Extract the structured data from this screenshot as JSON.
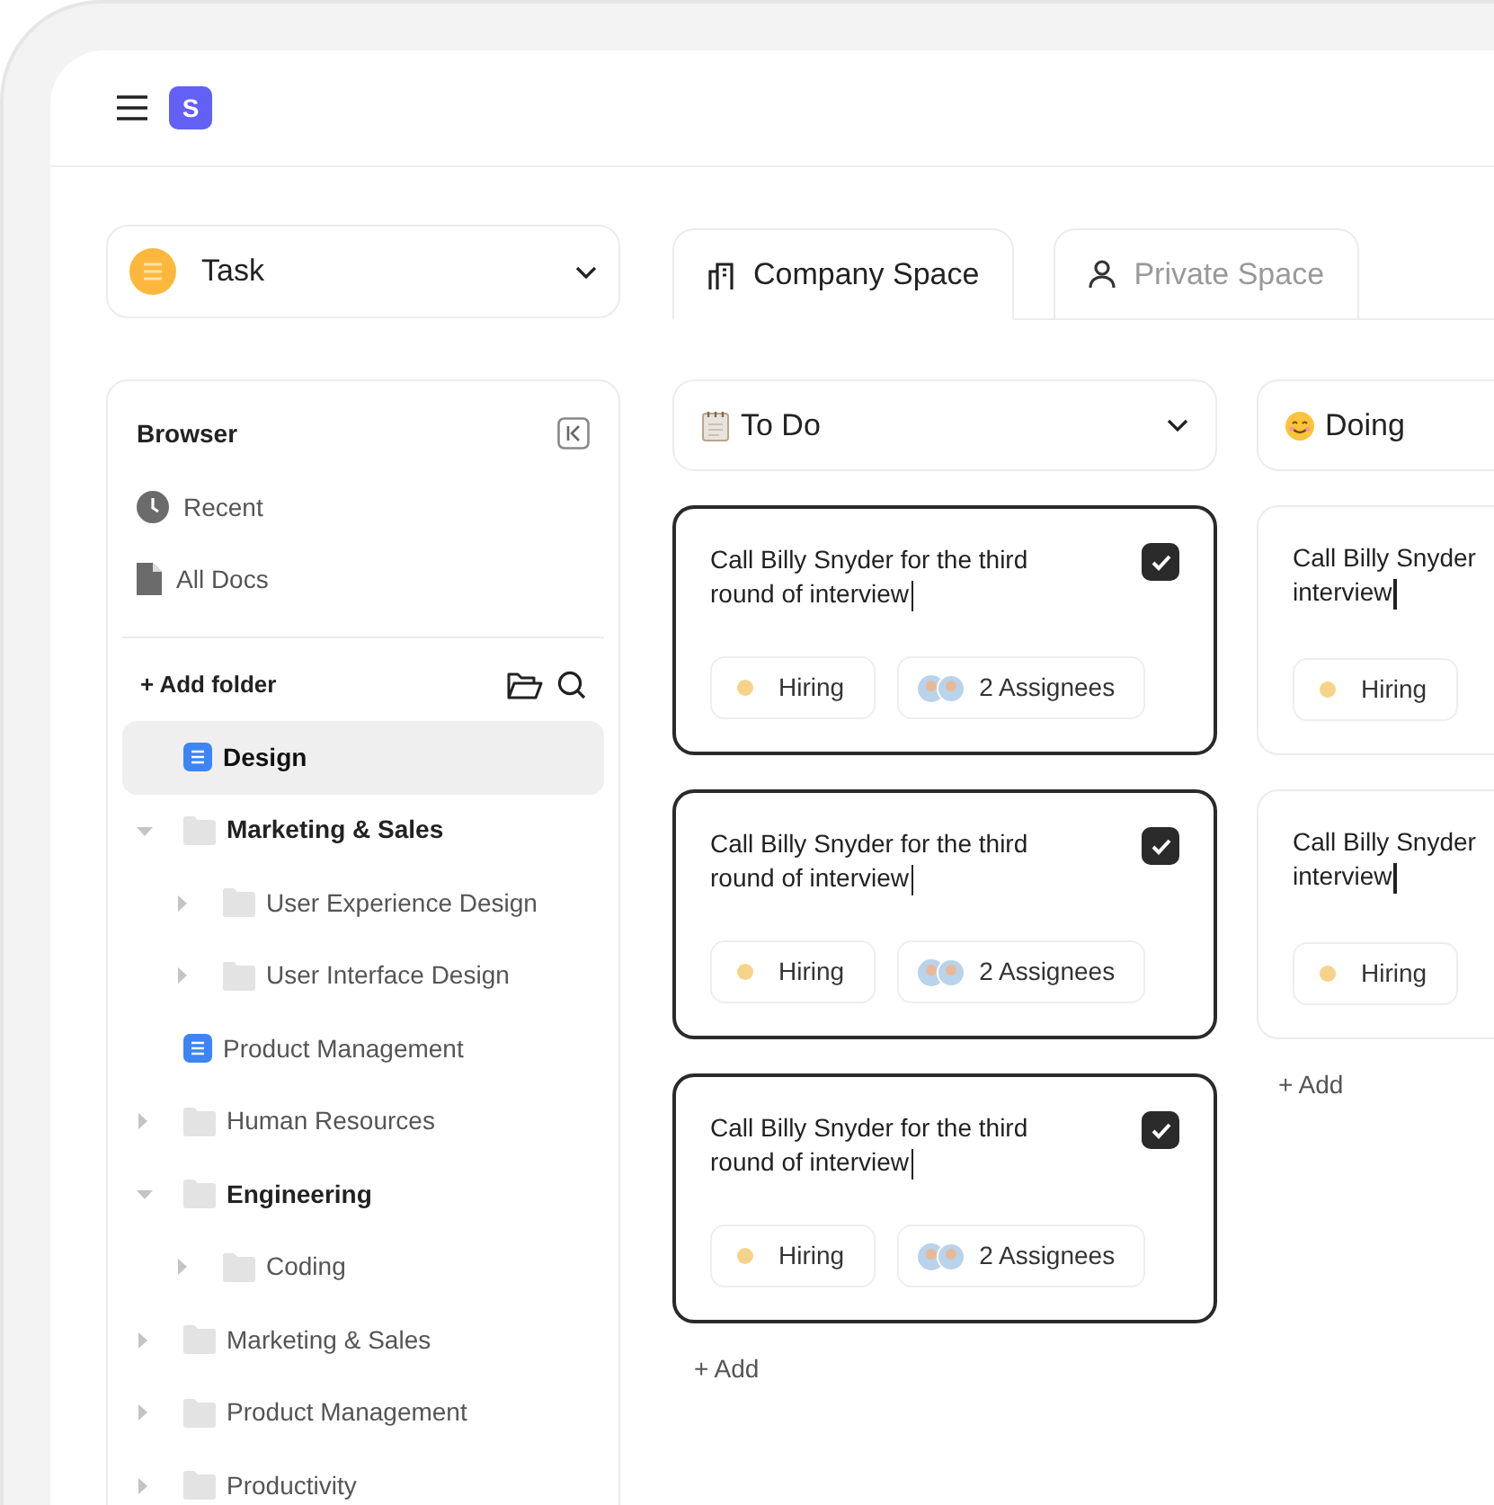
{
  "header": {
    "logo": "S"
  },
  "workspace_select": {
    "value": "Task"
  },
  "tabs": [
    {
      "label": "Company Space",
      "selected": true
    },
    {
      "label": "Private Space",
      "selected": false
    }
  ],
  "sidebar": {
    "title": "Browser",
    "links": [
      {
        "label": "Recent"
      },
      {
        "label": "All Docs"
      }
    ],
    "add_folder": "+ Add folder",
    "tree": [
      {
        "label": "Design",
        "kind": "doc",
        "selected": true
      },
      {
        "label": "Marketing & Sales",
        "kind": "folder",
        "expanded": true,
        "selected": false,
        "children": [
          {
            "label": "User Experience Design",
            "kind": "folder",
            "expanded": false,
            "selected": false
          },
          {
            "label": "User Interface Design",
            "kind": "folder",
            "expanded": false,
            "selected": false
          }
        ]
      },
      {
        "label": "Product Management",
        "kind": "doc",
        "selected": false
      },
      {
        "label": "Human Resources",
        "kind": "folder",
        "expanded": false,
        "selected": false
      },
      {
        "label": "Engineering",
        "kind": "folder",
        "expanded": true,
        "selected": false,
        "children": [
          {
            "label": "Coding",
            "kind": "folder",
            "expanded": false,
            "selected": false
          }
        ]
      },
      {
        "label": "Marketing & Sales",
        "kind": "folder",
        "expanded": false,
        "selected": false
      },
      {
        "label": "Product Management",
        "kind": "folder",
        "expanded": false,
        "selected": false
      },
      {
        "label": "Productivity",
        "kind": "folder",
        "expanded": false,
        "selected": false
      }
    ]
  },
  "board": {
    "columns": [
      {
        "title": "To Do",
        "dropdown": true,
        "add": "+ Add",
        "cards": [
          {
            "lines": [
              "Call Billy Snyder for the third",
              "round of interview"
            ],
            "checked": true,
            "tag": "Hiring",
            "color": "#f5d38a",
            "assignees": "2 Assignees",
            "active": true
          },
          {
            "lines": [
              "Call Billy Snyder for the third",
              "round of interview"
            ],
            "checked": true,
            "tag": "Hiring",
            "color": "#f5d38a",
            "assignees": "2 Assignees",
            "active": true
          },
          {
            "lines": [
              "Call Billy Snyder for the third",
              "round of interview"
            ],
            "checked": true,
            "tag": "Hiring",
            "color": "#f5d38a",
            "assignees": "2 Assignees",
            "active": true
          }
        ]
      },
      {
        "title": "Doing",
        "add": "+ Add",
        "cards": [
          {
            "lines": [
              "Call Billy Snyder",
              "interview"
            ],
            "tag": "Hiring",
            "color": "#f5d38a",
            "active": false
          },
          {
            "lines": [
              "Call Billy Snyder",
              "interview"
            ],
            "tag": "Hiring",
            "color": "#f5d38a",
            "active": false
          }
        ]
      }
    ]
  }
}
